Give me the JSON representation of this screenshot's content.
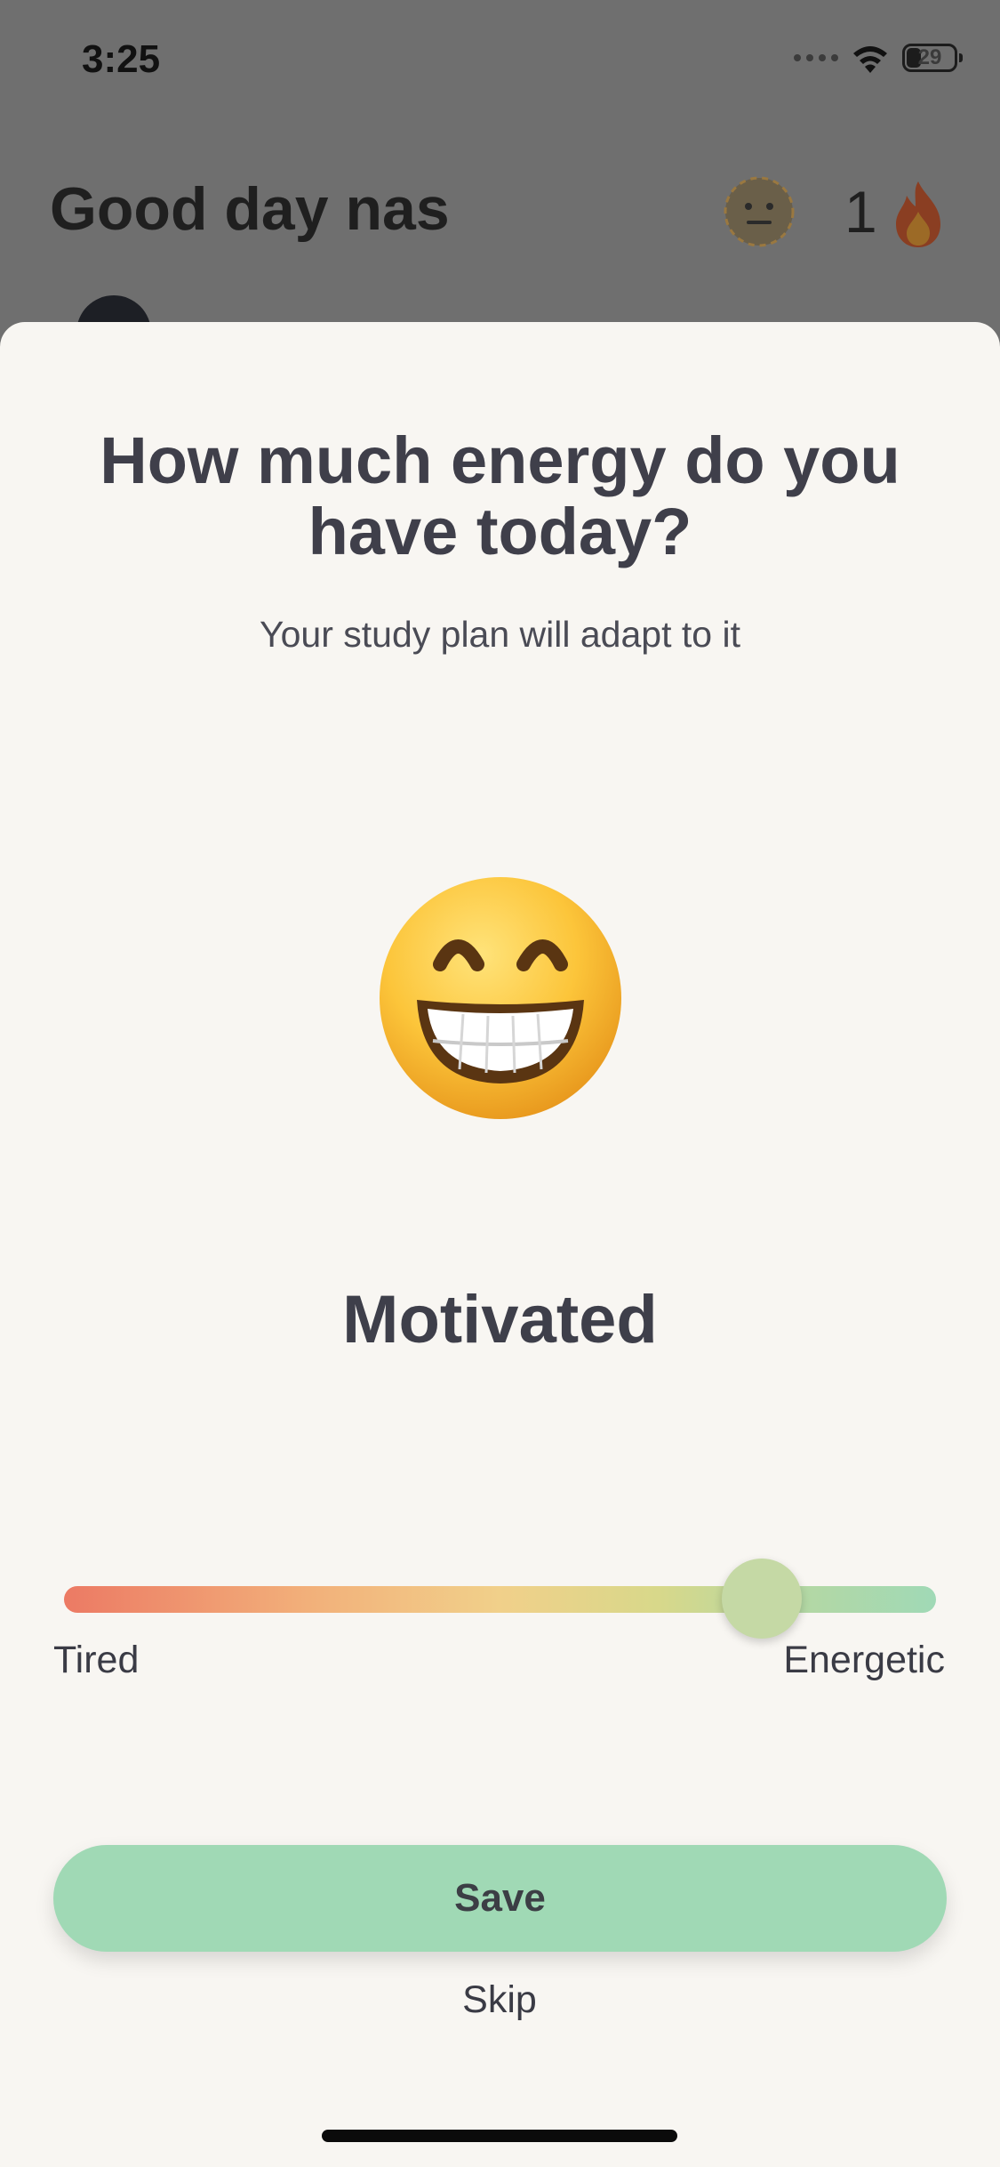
{
  "status_bar": {
    "time": "3:25",
    "battery_level": "29",
    "icons": [
      "cellular-signal-icon",
      "wifi-icon",
      "battery-icon"
    ]
  },
  "background": {
    "greeting": "Good day nas",
    "streak_count": "1",
    "icons": [
      "neutral-face-icon",
      "flame-icon"
    ]
  },
  "sheet": {
    "title": "How much energy do you have today?",
    "subtitle": "Your study plan will adapt to it",
    "mood_icon": "grinning-face-icon",
    "mood_label": "Motivated",
    "slider": {
      "min_label": "Tired",
      "max_label": "Energetic",
      "value": 0.8
    },
    "save_label": "Save",
    "skip_label": "Skip"
  },
  "colors": {
    "sheet_background": "#f8f6f2",
    "text_primary": "#3f3f4a",
    "accent_green": "#a0d9b5",
    "slider_start": "#ec7a64",
    "slider_mid": "#f1d08a",
    "slider_end": "#a0d9b6",
    "overlay_dim": "#6f6f6f"
  }
}
